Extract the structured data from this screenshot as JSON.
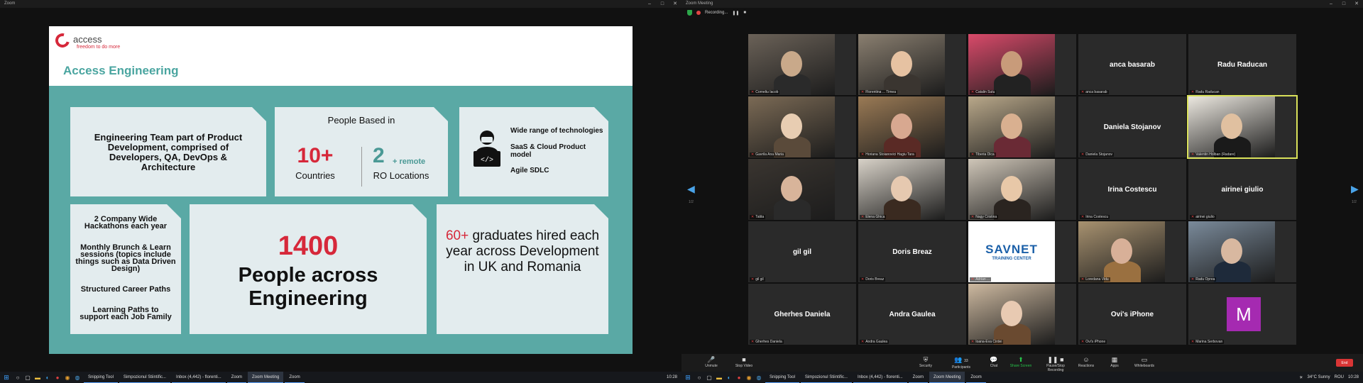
{
  "left_window": {
    "title": "Zoom",
    "slide": {
      "logo_text": "access",
      "logo_tagline": "freedom to do more",
      "title": "Access Engineering",
      "box1_text": "Engineering Team part of Product Development, comprised of Developers, QA, DevOps & Architecture",
      "box2_heading": "People Based in",
      "box2_stat1_value": "10+",
      "box2_stat1_label": "Countries",
      "box2_stat2_value": "2",
      "box2_stat2_suffix": "+ remote",
      "box2_stat2_label": "RO Locations",
      "box3_items": [
        "Wide range of technologies",
        "SaaS & Cloud Product model",
        "Agile SDLC"
      ],
      "box4_items": [
        "2 Company Wide Hackathons each year",
        "Monthly Brunch & Learn sessions (topics include things such as Data Driven Design)",
        "Structured Career Paths",
        "Learning Paths to support each Job Family"
      ],
      "box5_value": "1400",
      "box5_label": "People across Engineering",
      "box6_value": "60+",
      "box6_text": "graduates hired each year across Development in UK and Romania"
    }
  },
  "right_window": {
    "title": "Zoom Meeting",
    "recording_label": "Recording...",
    "tiles": [
      {
        "name": "Corneliu Iacob",
        "type": "video"
      },
      {
        "name": "Florentina ... Timea",
        "type": "video"
      },
      {
        "name": "Catalin Sutu",
        "type": "video"
      },
      {
        "name": "anca basarab",
        "type": "name"
      },
      {
        "name": "Radu Raducan",
        "type": "name"
      },
      {
        "name": "Gavrila Ana Maria",
        "type": "video"
      },
      {
        "name": "Horiana Stoianovici Hagiu Tara",
        "type": "video"
      },
      {
        "name": "Tiberia Dica",
        "type": "video"
      },
      {
        "name": "Daniela Stojanov",
        "type": "name"
      },
      {
        "name": "Valentin Holban (Radare)",
        "type": "video"
      },
      {
        "name": "Tatita",
        "type": "video"
      },
      {
        "name": "Elena Ghica",
        "type": "video"
      },
      {
        "name": "Nagy Cristina",
        "type": "video"
      },
      {
        "name": "Irina Costescu",
        "type": "name"
      },
      {
        "name": "airinei giulio",
        "type": "name"
      },
      {
        "name": "gil gil",
        "type": "name"
      },
      {
        "name": "Doris Breaz",
        "type": "name"
      },
      {
        "name": "Adrian ...",
        "type": "logo",
        "logo_text": "SAVNET",
        "logo_sub": "TRAINING CENTER"
      },
      {
        "name": "Loredana Vidu",
        "type": "video"
      },
      {
        "name": "Radu Oprea",
        "type": "video"
      },
      {
        "name": "Gherhes Daniela",
        "type": "name"
      },
      {
        "name": "Andra Gaulea",
        "type": "name"
      },
      {
        "name": "Ioana-Eva Cirdei",
        "type": "video"
      },
      {
        "name": "Ovi's iPhone",
        "type": "name"
      },
      {
        "name": "Marina Serbovan",
        "type": "avatar",
        "initial": "M"
      }
    ],
    "page_left": "1/2",
    "page_right": "1/2",
    "controls": [
      {
        "label": "Unmute",
        "icon": "🎤"
      },
      {
        "label": "Stop Video",
        "icon": "■"
      },
      {
        "label": "Security",
        "icon": "⛨"
      },
      {
        "label": "Participants",
        "icon": "👥"
      },
      {
        "label": "Chat",
        "icon": "💬"
      },
      {
        "label": "Share Screen",
        "icon": "↑"
      },
      {
        "label": "Pause/Stop Recording",
        "icon": "❚❚"
      },
      {
        "label": "Reactions",
        "icon": "☺"
      },
      {
        "label": "Apps",
        "icon": "▦"
      },
      {
        "label": "Whiteboards",
        "icon": "▭"
      }
    ],
    "participants_count": "33",
    "end_label": "End"
  },
  "taskbar_left": {
    "apps": [
      "Snipping Tool",
      "Simpozionul Stiintific...",
      "Inbox (4,442) - florenti...",
      "Zoom",
      "Zoom Meeting",
      "Zoom"
    ],
    "time": "10:28"
  },
  "taskbar_right": {
    "apps": [
      "Snipping Tool",
      "Simpozionul Stiintific...",
      "Inbox (4,442) - florenti...",
      "Zoom",
      "Zoom Meeting",
      "Zoom"
    ],
    "weather": "34°C Sunny",
    "lang": "ROU",
    "time": "10:28"
  },
  "colors": {
    "slide_teal": "#5aa9a5",
    "slide_red": "#d6283a",
    "accent": "#4aa5a0"
  }
}
